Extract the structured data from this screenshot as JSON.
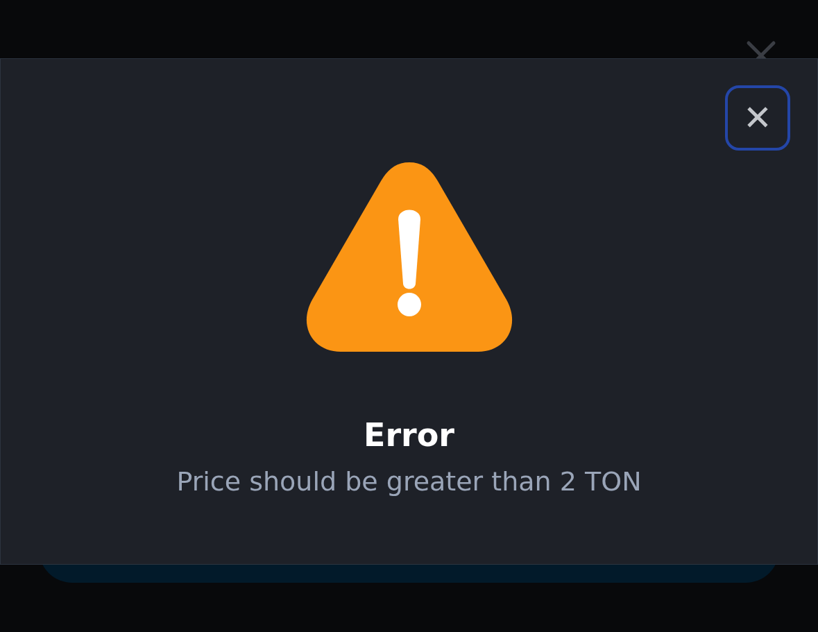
{
  "error_dialog": {
    "close_label": "✕",
    "title": "Error",
    "message": "Price should be greater than 2 TON"
  }
}
